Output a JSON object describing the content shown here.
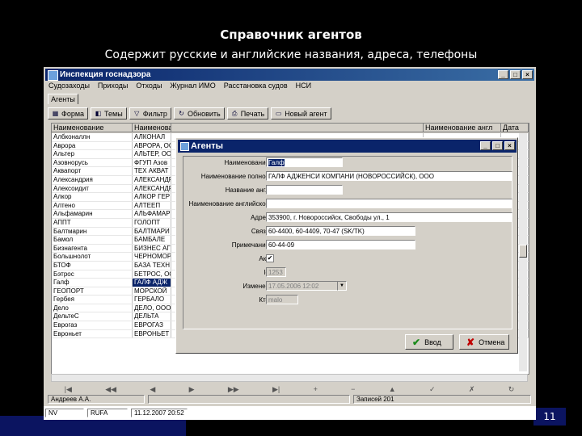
{
  "slide": {
    "title": "Справочник агентов",
    "subtitle": "Содержит русские и английские названия, адреса, телефоны",
    "page_number": "11"
  },
  "app": {
    "title": "Инспекция госнадзора",
    "window_buttons": [
      "_",
      "□",
      "×"
    ],
    "menu": [
      "Судозаходы",
      "Приходы",
      "Отходы",
      "Журнал ИМО",
      "Расстановка судов",
      "НСИ"
    ],
    "tab": "Агенты",
    "toolbar": [
      "Форма",
      "Темы",
      "Фильтр",
      "Обновить",
      "Печать",
      "Новый агент"
    ],
    "grid": {
      "headers": [
        "Наименование",
        "Наименование полное",
        "",
        "Наименование англ",
        "Дата"
      ],
      "rows": [
        [
          "Албконаллн",
          "АЛКОНАЛ"
        ],
        [
          "Аврора",
          "АВРОРА, ООО"
        ],
        [
          "Альтер",
          "АЛЬТЕР, ООО"
        ],
        [
          "Азовнорусь",
          "ФГУП Азов"
        ],
        [
          "Аквапорт",
          "ТЕХ АКВАТ"
        ],
        [
          "Александрия",
          "АЛЕКСАНДР"
        ],
        [
          "Алексоидит",
          "АЛЕКСАНДР"
        ],
        [
          "Алкор",
          "АЛКОР ГЕР"
        ],
        [
          "Алтено",
          "АЛТЕЕП"
        ],
        [
          "Альфамарин",
          "АЛЬФАМАР"
        ],
        [
          "АППТ",
          "ГОЛОПТ"
        ],
        [
          "Балтмарин",
          "БАЛТМАРИ"
        ],
        [
          "Бамол",
          "БАМБАЛЕ"
        ],
        [
          "Бизнагента",
          "БИЗНЕС АГЕ"
        ],
        [
          "Большнолот",
          "ЧЕРНОМОР"
        ],
        [
          "БТОФ",
          "БАЗА ТЕХН"
        ],
        [
          "Бэтрос",
          "БЕТРОС, ООО"
        ],
        [
          "Галф",
          "ГАЛФ АДЖ"
        ],
        [
          "ГЕОПОРТ",
          "МОРСКОЙ"
        ],
        [
          "Гербея",
          "ГЕРБАЛО"
        ],
        [
          "Дело",
          "ДЕЛО, ООО"
        ],
        [
          "ДельтеС",
          "ДЕЛЬТА"
        ],
        [
          "Еврогаз",
          "ЕВРОГАЗ"
        ],
        [
          "Евроньет",
          "ЕВРОНЬЕТ"
        ]
      ],
      "selected_row_index": 17
    },
    "navbar": [
      "|◀",
      "◀◀",
      "◀",
      "▶",
      "▶▶",
      "▶|",
      "+",
      "−",
      "▲",
      "✓",
      "✗",
      "↻"
    ],
    "status_user": "Андреев А.А.",
    "status_records": "Записей 201",
    "status_bottom": [
      "NV",
      "RUFA",
      "11.12.2007 20:52"
    ]
  },
  "dialog": {
    "title": "Агенты",
    "fields": [
      {
        "label": "Наименование",
        "value": "Галф",
        "highlight": true
      },
      {
        "label": "Наименование полное",
        "value": "ГАЛФ АДЖЕНСИ КОМПАНИ (НОВОРОССИЙСК), ООО"
      },
      {
        "label": "Название англ",
        "value": ""
      },
      {
        "label": "Наименование английское",
        "value": ""
      },
      {
        "label": "Адрес",
        "value": "353900, г. Новороссийск, Свободы ул., 1"
      },
      {
        "label": "Связь",
        "value": "60-4400, 60-4409, 70-47 (SK/TK)"
      },
      {
        "label": "Примечание",
        "value": "60-44-09"
      }
    ],
    "active_label": "Акт",
    "active_mark": "✔",
    "id_label": "Id",
    "id_value": "1253",
    "changed_label": "Изменен",
    "changed_value": "17.05.2006 12:02",
    "who_label": "Кто",
    "who_value": "malo",
    "ok_label": "Ввод",
    "cancel_label": "Отмена"
  }
}
